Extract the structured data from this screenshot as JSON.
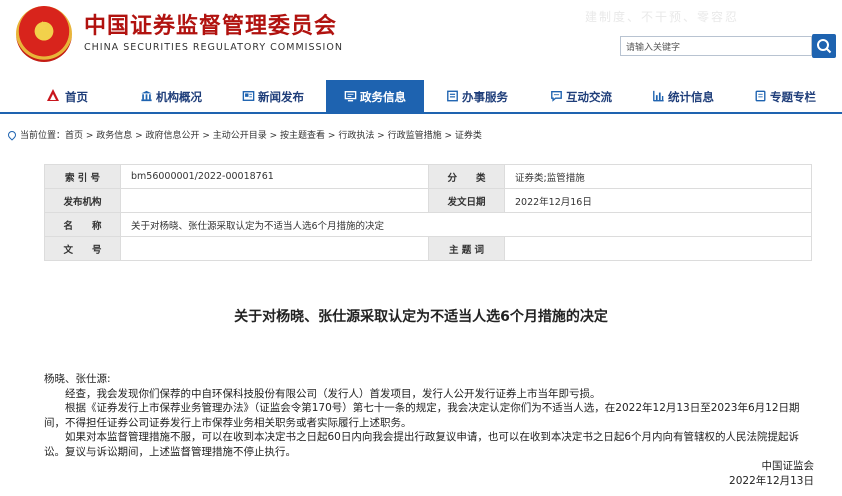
{
  "header": {
    "title": "中国证券监督管理委员会",
    "subtitle": "CHINA SECURITIES REGULATORY COMMISSION",
    "slogan": "建制度、不干预、零容忍",
    "search_placeholder": "请输入关键字"
  },
  "nav": {
    "items": [
      {
        "label": "首页",
        "icon": "home-icon"
      },
      {
        "label": "机构概况",
        "icon": "building-icon"
      },
      {
        "label": "新闻发布",
        "icon": "news-icon"
      },
      {
        "label": "政务信息",
        "icon": "monitor-icon"
      },
      {
        "label": "办事服务",
        "icon": "service-icon"
      },
      {
        "label": "互动交流",
        "icon": "chat-icon"
      },
      {
        "label": "统计信息",
        "icon": "chart-icon"
      },
      {
        "label": "专题专栏",
        "icon": "document-icon"
      }
    ],
    "active_index": 3
  },
  "breadcrumb": "当前位置：首页 > 政务信息 > 政府信息公开 > 主动公开目录 > 按主题查看 > 行政执法 > 行政监管措施 > 证券类",
  "info": {
    "index_label": "索 引 号",
    "index_value": "bm56000001/2022-00018761",
    "category_label": "分　　类",
    "category_value": "证券类;监管措施",
    "publisher_label": "发布机构",
    "publisher_value": "",
    "date_label": "发文日期",
    "date_value": "2022年12月16日",
    "name_label": "名　　称",
    "name_value": "关于对杨晓、张仕源采取认定为不适当人选6个月措施的决定",
    "docno_label": "文　　号",
    "docno_value": "",
    "keyword_label": "主 题 词",
    "keyword_value": ""
  },
  "document": {
    "title": "关于对杨晓、张仕源采取认定为不适当人选6个月措施的决定",
    "salutation": "杨晓、张仕源:",
    "para1": "经查，我会发现你们保荐的中自环保科技股份有限公司（发行人）首发项目，发行人公开发行证券上市当年即亏损。",
    "para2": "根据《证券发行上市保荐业务管理办法》（证监会令第170号）第七十一条的规定，我会决定认定你们为不适当人选，在2022年12月13日至2023年6月12日期间，不得担任证券公司证券发行上市保荐业务相关职务或者实际履行上述职务。",
    "para3": "如果对本监督管理措施不服，可以在收到本决定书之日起60日内向我会提出行政复议申请，也可以在收到本决定书之日起6个月内向有管辖权的人民法院提起诉讼。复议与诉讼期间，上述监督管理措施不停止执行。",
    "signature": "中国证监会",
    "sign_date": "2022年12月13日"
  }
}
